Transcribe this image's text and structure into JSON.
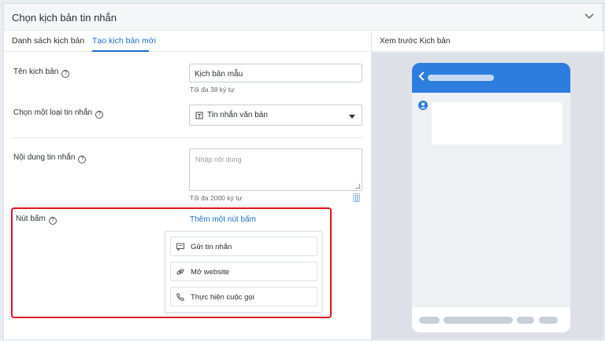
{
  "header": {
    "title": "Chọn kịch bản tin nhắn",
    "collapse_icon": "chevron-down-icon"
  },
  "tabs": [
    {
      "label": "Danh sách kịch bản",
      "active": false
    },
    {
      "label": "Tạo kịch bản mới",
      "active": true
    }
  ],
  "form": {
    "name": {
      "label": "Tên kịch bản",
      "value": "Kịch bản mẫu",
      "hint": "Tối đa 38 ký tự"
    },
    "type": {
      "label": "Chọn một loại tin nhắn",
      "value": "Tin nhắn văn bản"
    },
    "content": {
      "label": "Nội dung tin nhắn",
      "placeholder": "Nhập nội dung",
      "hint": "Tối đa 2000 ký tự",
      "code_icon": "{}"
    },
    "buttons": {
      "label": "Nút bấm",
      "add_link": "Thêm một nút bấm",
      "options": [
        {
          "label": "Gửi tin nhắn",
          "icon": "message-icon"
        },
        {
          "label": "Mở website",
          "icon": "link-icon"
        },
        {
          "label": "Thực hiện cuộc gọi",
          "icon": "phone-icon"
        }
      ]
    }
  },
  "preview": {
    "title": "Xem trước Kịch bản",
    "accent": "#2d7dde"
  },
  "colors": {
    "accent": "#1f6fc5",
    "highlight": "#e0151b"
  }
}
